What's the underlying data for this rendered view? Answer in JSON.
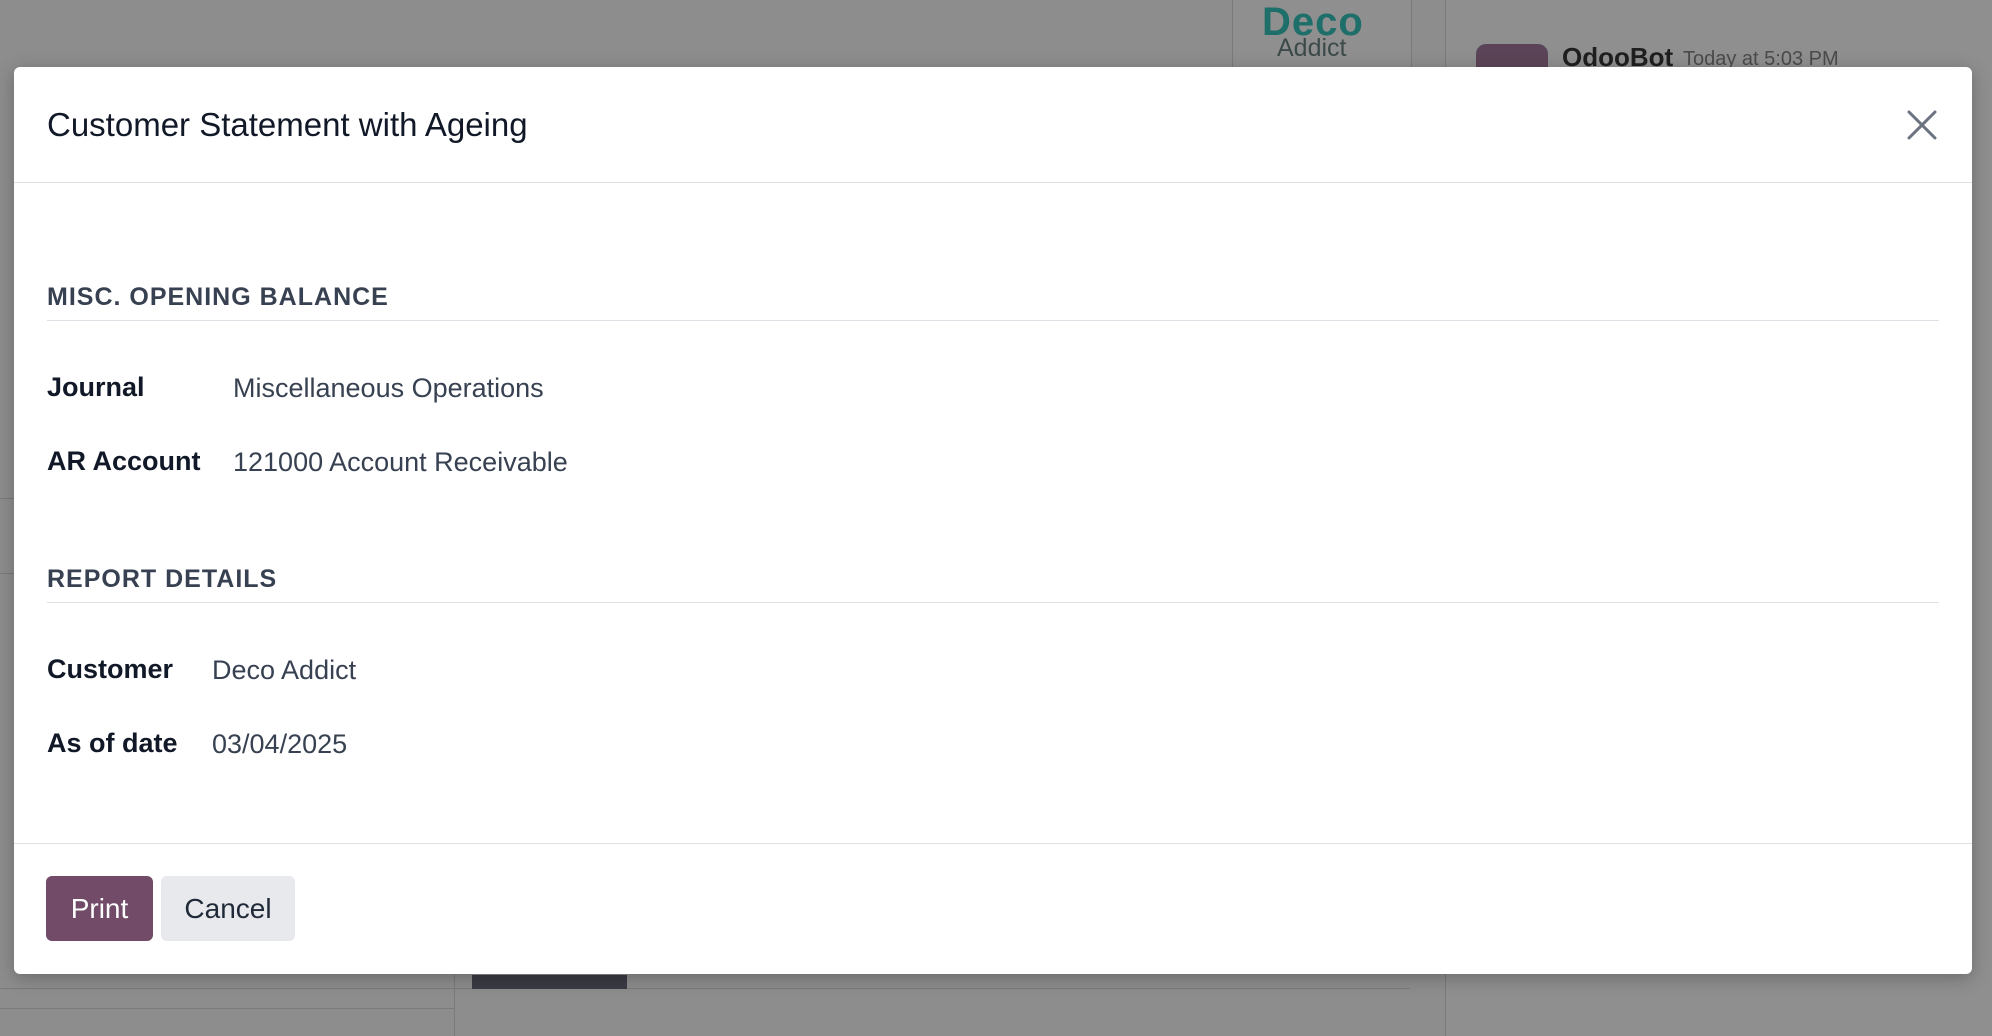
{
  "background": {
    "logo_title": "Deco",
    "logo_subtitle": "Addict",
    "chatter_author": "OdooBot",
    "chatter_time": "Today at 5:03 PM"
  },
  "modal": {
    "title": "Customer Statement with Ageing",
    "close_icon": "close-icon",
    "sections": {
      "opening_balance": {
        "title": "MISC. OPENING BALANCE",
        "fields": [
          {
            "label": "Journal",
            "value": "Miscellaneous Operations"
          },
          {
            "label": "AR Account",
            "value": "121000 Account Receivable"
          }
        ]
      },
      "report_details": {
        "title": "REPORT DETAILS",
        "fields": [
          {
            "label": "Customer",
            "value": "Deco Addict"
          },
          {
            "label": "As of date",
            "value": "03/04/2025"
          }
        ]
      }
    },
    "footer": {
      "print_label": "Print",
      "cancel_label": "Cancel"
    }
  },
  "colors": {
    "primary": "#714b67",
    "secondary": "#e7e9ed",
    "overlay": "#8a8a8a"
  }
}
